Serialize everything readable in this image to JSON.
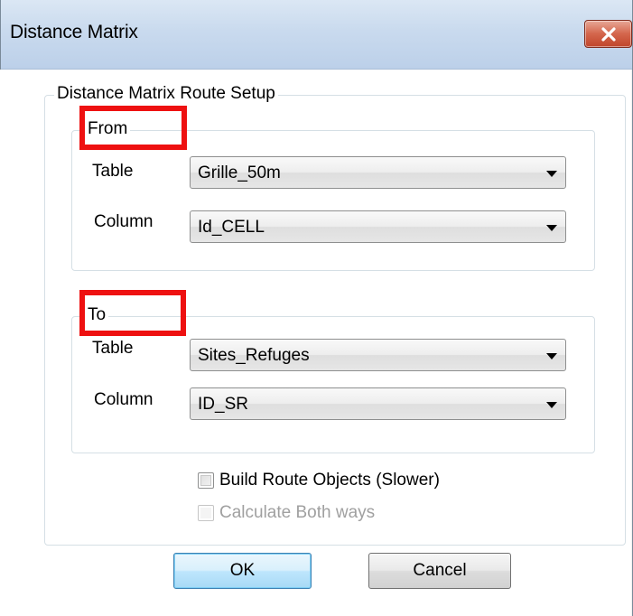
{
  "window": {
    "title": "Distance Matrix",
    "close_icon": "close-icon"
  },
  "setup": {
    "legend": "Distance Matrix Route Setup",
    "from": {
      "legend": "From",
      "table_label": "Table",
      "table_value": "Grille_50m",
      "column_label": "Column",
      "column_value": "Id_CELL"
    },
    "to": {
      "legend": "To",
      "table_label": "Table",
      "table_value": "Sites_Refuges",
      "column_label": "Column",
      "column_value": "ID_SR"
    },
    "build_routes": {
      "label": "Build Route Objects (Slower)",
      "checked": false,
      "enabled": true
    },
    "both_ways": {
      "label": "Calculate Both ways",
      "checked": false,
      "enabled": false
    }
  },
  "buttons": {
    "ok": "OK",
    "cancel": "Cancel"
  },
  "colors": {
    "annotation": "#ee1111",
    "close_button": "#c0452b"
  }
}
